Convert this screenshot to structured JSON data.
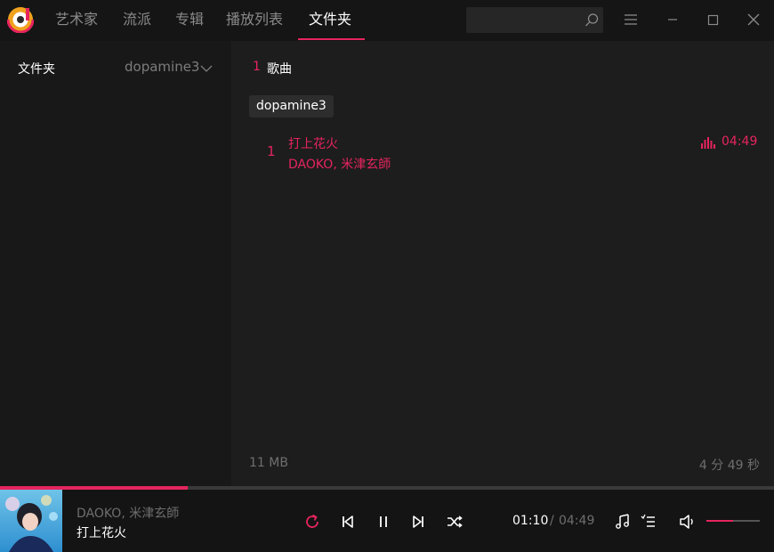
{
  "nav": {
    "tabs": [
      {
        "label": "艺术家"
      },
      {
        "label": "流派"
      },
      {
        "label": "专辑"
      },
      {
        "label": "播放列表"
      },
      {
        "label": "文件夹"
      }
    ],
    "active_tab": "文件夹"
  },
  "search": {
    "placeholder": ""
  },
  "window_controls": [
    "menu-icon",
    "minimize-icon",
    "maximize-icon",
    "close-icon"
  ],
  "sidebar": {
    "title": "文件夹",
    "selected_folder": "dopamine3"
  },
  "main": {
    "song_count": "1",
    "song_count_label": "歌曲",
    "folder_chip": "dopamine3",
    "tracks": [
      {
        "number": "1",
        "title": "打上花火",
        "artist": "DAOKO, 米津玄師",
        "duration": "04:49",
        "playing": true
      }
    ],
    "footer_size": "11 MB",
    "footer_total_duration": "4 分 49 秒"
  },
  "player": {
    "artist": "DAOKO, 米津玄師",
    "title": "打上花火",
    "current_time": "01:10",
    "separator": "/",
    "total_time": "04:49",
    "progress_fraction": 0.242,
    "volume_fraction": 0.5
  },
  "colors": {
    "accent": "#e6245e",
    "background": "#1b1b1b",
    "sidebar": "#181818",
    "titlebar": "#151515"
  }
}
